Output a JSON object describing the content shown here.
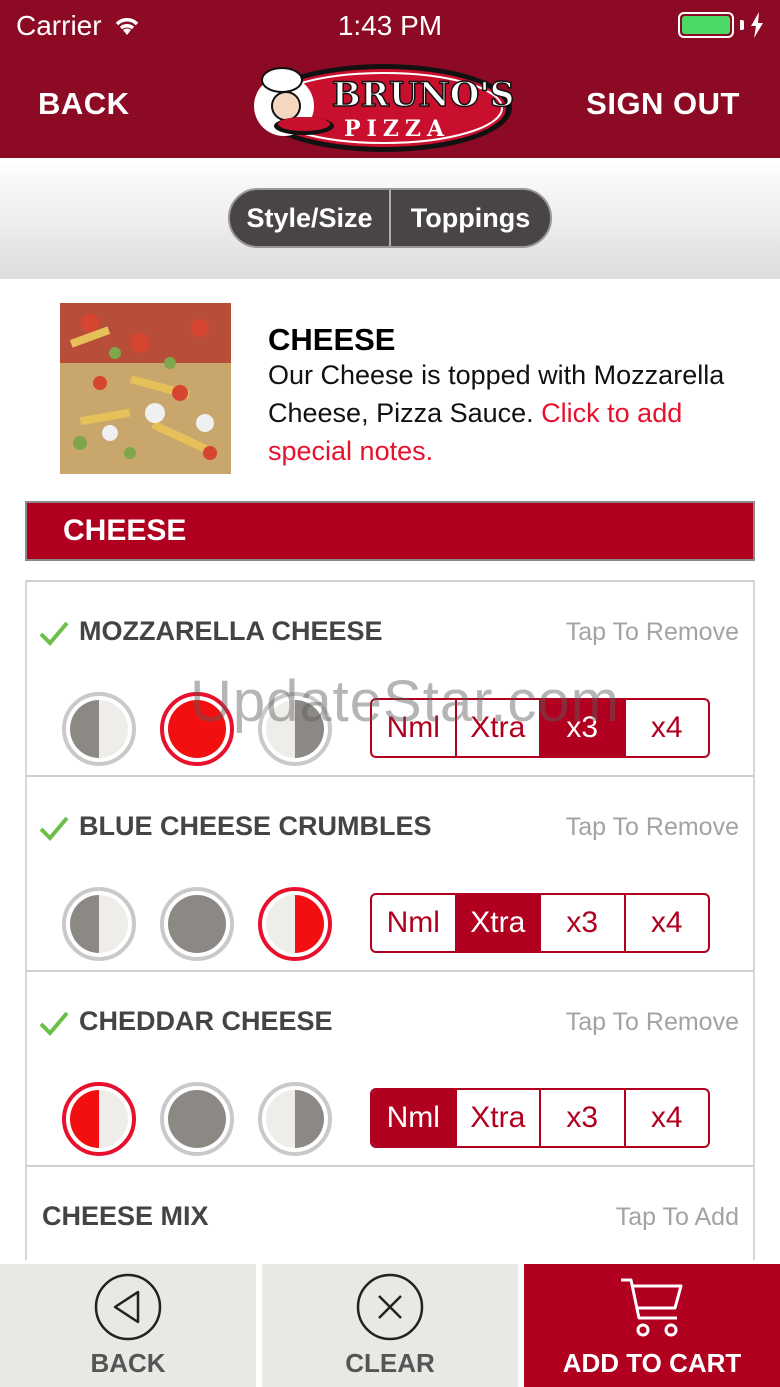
{
  "status_bar": {
    "carrier": "Carrier",
    "time": "1:43 PM"
  },
  "nav": {
    "back": "BACK",
    "sign_out": "SIGN OUT",
    "logo_text_top": "BRUNO'S",
    "logo_text_bottom": "PIZZA"
  },
  "segments": [
    {
      "label": "Style/Size"
    },
    {
      "label": "Toppings"
    }
  ],
  "product": {
    "title": "CHEESE",
    "description": "Our Cheese is topped with Mozzarella Cheese, Pizza Sauce. ",
    "notes_link": "Click to add special notes."
  },
  "category": {
    "title": "CHEESE"
  },
  "toppings": [
    {
      "name": "MOZZARELLA CHEESE",
      "action": "Tap To Remove",
      "selected_portion": "whole",
      "quantity": [
        "Nml",
        "Xtra",
        "x3",
        "x4"
      ],
      "active_quantity": "x3"
    },
    {
      "name": "BLUE CHEESE CRUMBLES",
      "action": "Tap To Remove",
      "selected_portion": "right",
      "quantity": [
        "Nml",
        "Xtra",
        "x3",
        "x4"
      ],
      "active_quantity": "Xtra"
    },
    {
      "name": "CHEDDAR CHEESE",
      "action": "Tap To Remove",
      "selected_portion": "left",
      "quantity": [
        "Nml",
        "Xtra",
        "x3",
        "x4"
      ],
      "active_quantity": "Nml"
    },
    {
      "name": "CHEESE MIX",
      "action": "Tap To Add"
    }
  ],
  "bottom_bar": {
    "back": "BACK",
    "clear": "CLEAR",
    "add_to_cart": "ADD TO CART"
  },
  "watermark": "UpdateStar.com",
  "colors": {
    "brand": "#8c0a23",
    "accent": "#b1001f",
    "selected": "#e8112d",
    "check": "#6cc04a"
  }
}
